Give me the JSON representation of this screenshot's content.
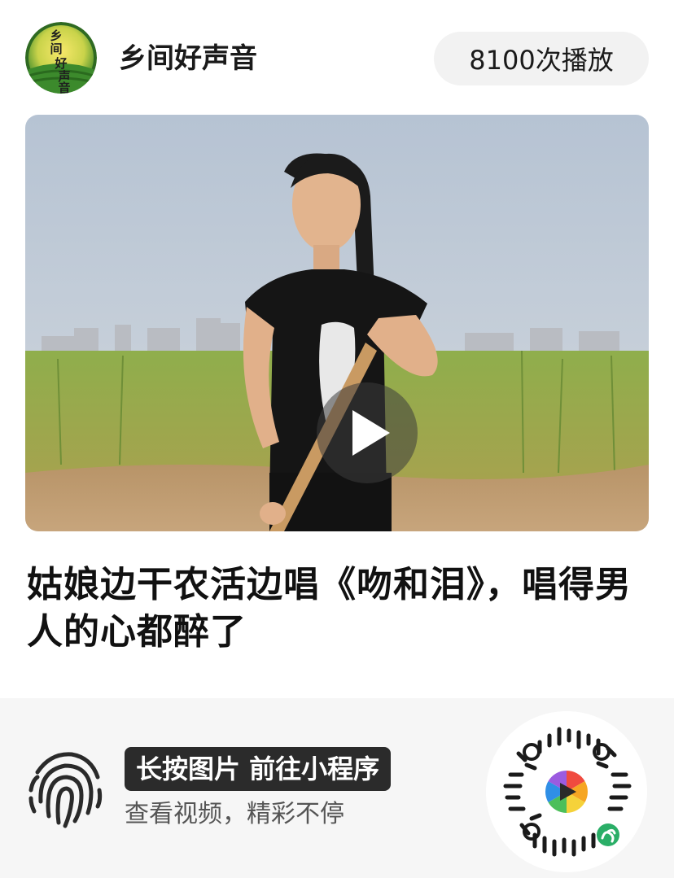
{
  "header": {
    "channel_name": "乡间好声音",
    "avatar_text": "乡间好声音",
    "play_count": "8100次播放"
  },
  "video": {
    "play_icon": "play-icon"
  },
  "article": {
    "title": "姑娘边干农活边唱《吻和泪》，唱得男人的心都醉了"
  },
  "footer": {
    "cta_label": "长按图片 前往小程序",
    "cta_sub": "查看视频，精彩不停",
    "fingerprint_icon": "fingerprint-icon",
    "qr_icon": "mini-program-qr-code"
  },
  "colors": {
    "badge_bg": "#2b2b2b",
    "pill_bg": "#f2f2f2",
    "footer_bg": "#f6f6f6",
    "mini_program_green": "#2aae67"
  }
}
